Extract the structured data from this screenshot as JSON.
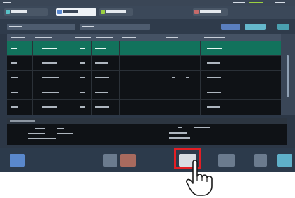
{
  "colors": {
    "background": "#2c3746",
    "selected_row": "#12725c",
    "highlight": "#e31e24",
    "accent_blue": "#5a88d0",
    "accent_cyan": "#58c2c8",
    "accent_green": "#9bd040"
  },
  "status_tabs": [
    {
      "icon": "status-swatch-icon"
    },
    {
      "icon": "selected-tab-icon"
    },
    {
      "icon": "green-swatch-icon"
    },
    {
      "icon": "system-swatch-icon"
    }
  ],
  "table": {
    "row_count": 5,
    "selected_row_index": 0
  },
  "toolbar": {
    "highlighted_button": "output-button",
    "icons": [
      "home-icon",
      "list-icon",
      "filter-icon",
      "output-icon",
      "settings-icon",
      "pause-icon",
      "next-icon"
    ]
  },
  "pointer": {
    "icon": "hand-pointer-icon"
  }
}
